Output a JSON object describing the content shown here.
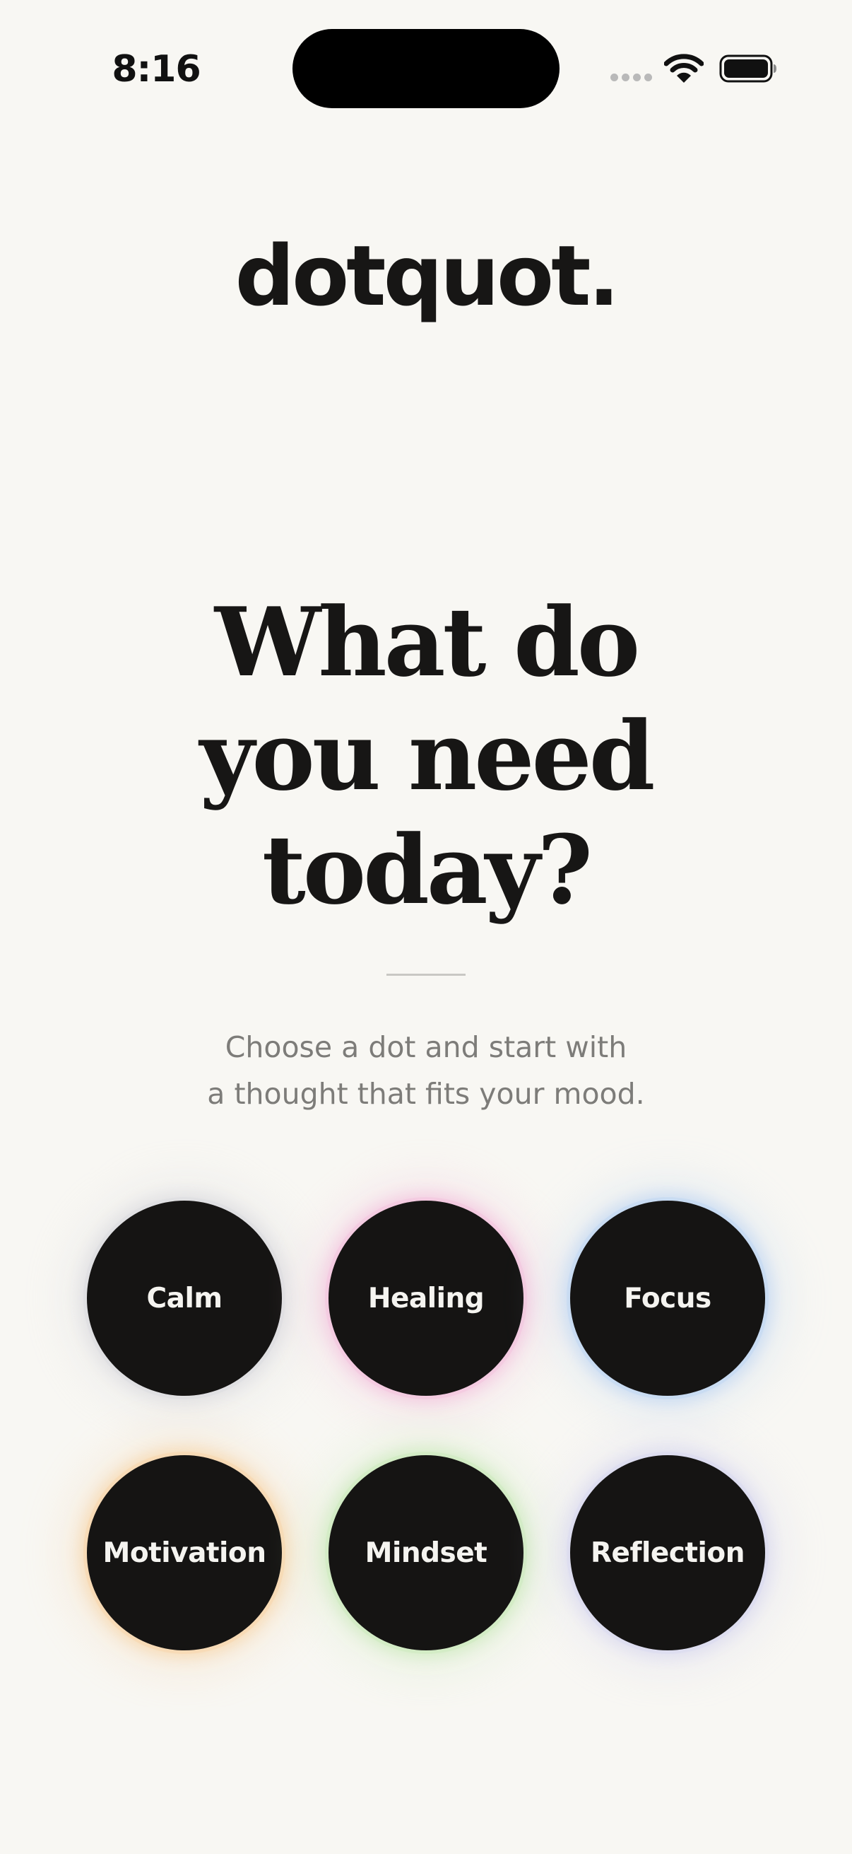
{
  "status_bar": {
    "time": "8:16",
    "icons": [
      "signal-icon",
      "wifi-icon",
      "battery-icon"
    ]
  },
  "app": {
    "logo": "dotquot."
  },
  "main": {
    "headline_lines": [
      "What do",
      "you need",
      "today?"
    ],
    "subtitle_lines": [
      "Choose a dot and start with",
      "a thought that fits your mood."
    ]
  },
  "moods": [
    {
      "label": "Calm",
      "glow": "#d9d9de"
    },
    {
      "label": "Healing",
      "glow": "#f3bfdc"
    },
    {
      "label": "Focus",
      "glow": "#bcd4f3"
    },
    {
      "label": "Motivation",
      "glow": "#f7d3a4"
    },
    {
      "label": "Mindset",
      "glow": "#c9e9b8"
    },
    {
      "label": "Reflection",
      "glow": "#d6d6ef"
    }
  ],
  "colors": {
    "background": "#f8f7f3",
    "dot": "#151413",
    "text": "#171615",
    "subtitle": "#7d7c79"
  }
}
